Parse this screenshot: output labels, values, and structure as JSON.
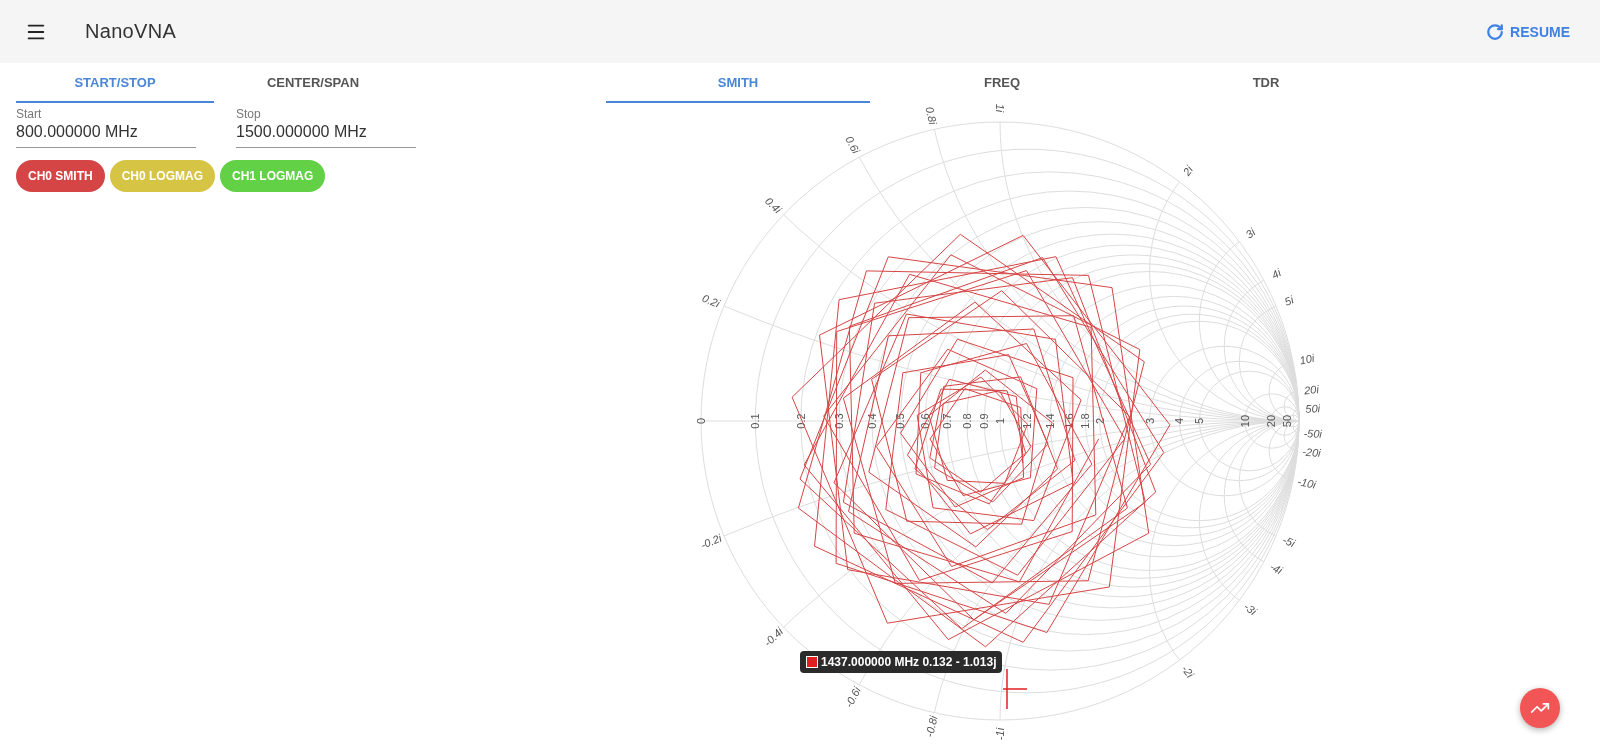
{
  "app_bar": {
    "title": "NanoVNA",
    "action": "RESUME"
  },
  "sweep_tabs": [
    {
      "label": "START/STOP",
      "selected": true
    },
    {
      "label": "CENTER/SPAN",
      "selected": false
    }
  ],
  "fields": [
    {
      "label": "Start",
      "value": "800.000000 MHz"
    },
    {
      "label": "Stop",
      "value": "1500.000000 MHz"
    }
  ],
  "channels": [
    {
      "label": "CH0 SMITH",
      "color": "#d64545"
    },
    {
      "label": "CH0 LOGMAG",
      "color": "#d6c545"
    },
    {
      "label": "CH1 LOGMAG",
      "color": "#62d145"
    }
  ],
  "view_tabs": [
    {
      "label": "SMITH",
      "selected": true
    },
    {
      "label": "FREQ",
      "selected": false
    },
    {
      "label": "TDR",
      "selected": false
    }
  ],
  "smith": {
    "resistance_labels": [
      "0",
      "0.1",
      "0.2",
      "0.3",
      "0.4",
      "0.5",
      "0.6",
      "0.7",
      "0.8",
      "0.9",
      "1",
      "1.2",
      "1.4",
      "1.6",
      "1.8",
      "2",
      "3",
      "4",
      "5",
      "10",
      "20",
      "50"
    ],
    "reactance_labels": [
      "0.2i",
      "0.4i",
      "0.6i",
      "0.8i",
      "1i",
      "2i",
      "3i",
      "4i",
      "5i",
      "10i",
      "20i",
      "50i",
      "-50i",
      "-20i",
      "-10i",
      "-5i",
      "-4i",
      "-3i",
      "-2i",
      "-1i",
      "-0.8i",
      "-0.6i",
      "-0.4i",
      "-0.2i"
    ],
    "marker": {
      "text": "1437.000000 MHz 0.132 - 1.013j",
      "color": "#e02020"
    }
  }
}
